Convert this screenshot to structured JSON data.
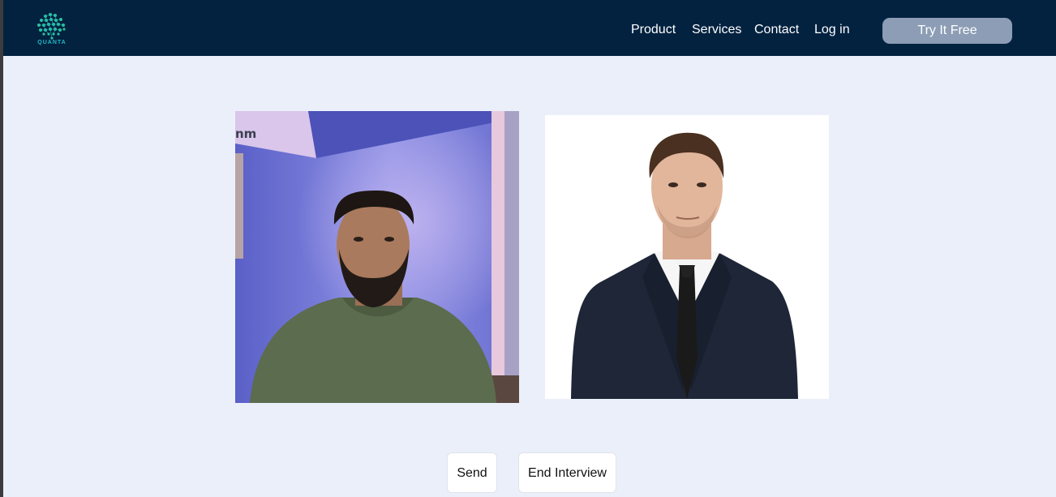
{
  "navbar": {
    "logo_text": "QUANTA",
    "links": [
      "Product",
      "Services",
      "Contact",
      "Log in"
    ],
    "cta_label": "Try It Free"
  },
  "video": {
    "user_feed_overlay_text": "nm"
  },
  "actions": {
    "send_label": "Send",
    "end_label": "End Interview"
  },
  "colors": {
    "navbar_bg": "#022240",
    "page_bg": "#ebeff9",
    "cta_bg": "#8c9db5",
    "logo_accent": "#23b8c4"
  }
}
